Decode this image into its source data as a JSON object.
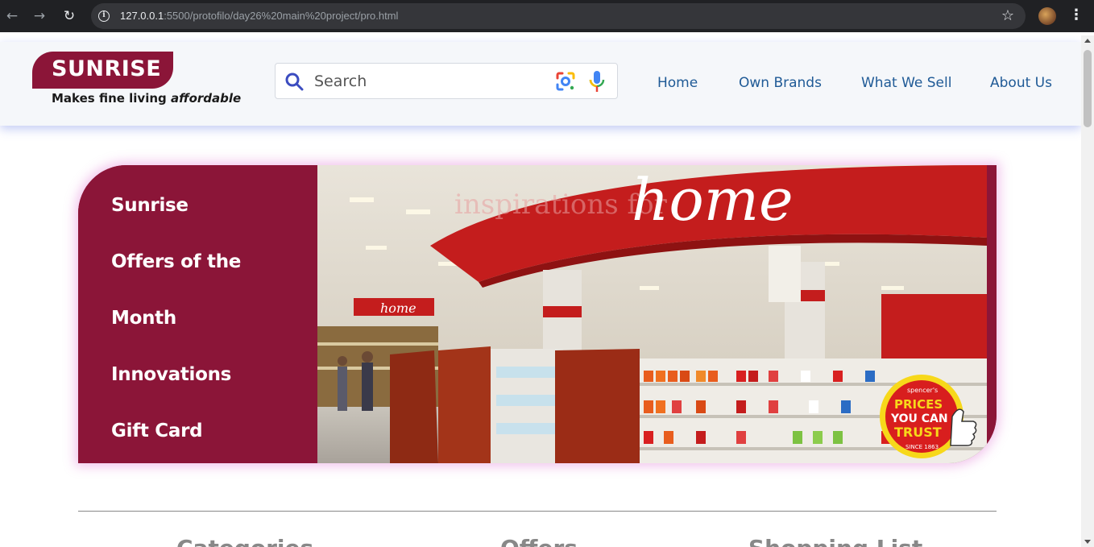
{
  "browser": {
    "url_host": "127.0.0.1",
    "url_path": ":5500/protofilo/day26%20main%20project/pro.html"
  },
  "header": {
    "brand": "SUNRISE",
    "tagline_prefix": "Makes fine living ",
    "tagline_emphasis": "affordable",
    "search_placeholder": "Search",
    "nav": [
      "Home",
      "Own Brands",
      "What We Sell",
      "About Us"
    ]
  },
  "hero": {
    "menu": [
      "Sunrise",
      "Offers of the",
      "Month",
      "Innovations",
      "Gift Card"
    ],
    "photo": {
      "sign_text": "home",
      "sign_subtext": "inspirations for",
      "aisle_sign": "home",
      "badge_top": "spencer's",
      "badge_line1": "PRICES",
      "badge_line2": "YOU CAN",
      "badge_line3": "TRUST",
      "badge_since": "SINCE 1863"
    }
  },
  "sections": [
    "Categories",
    "Offers",
    "Shopping List"
  ],
  "colors": {
    "brand": "#8b1538",
    "nav_link": "#1f5a96",
    "header_bg": "#f5f7fa"
  }
}
